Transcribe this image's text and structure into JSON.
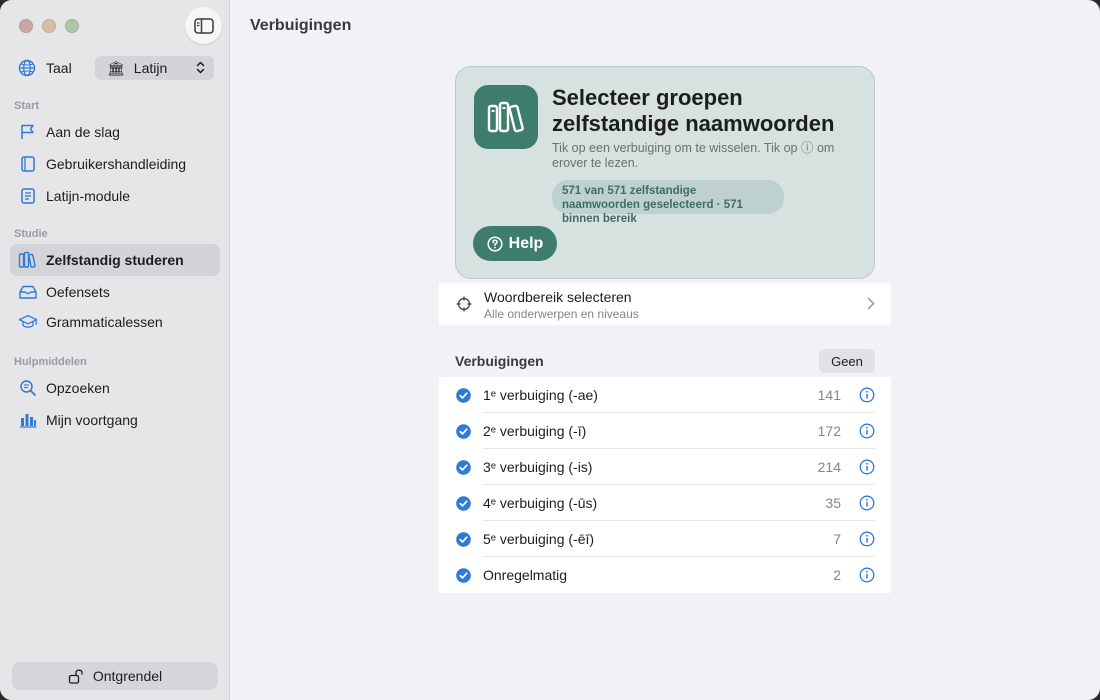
{
  "window": {
    "title": "Verbuigingen"
  },
  "sidebar": {
    "language_label": "Taal",
    "language_value": "Latijn",
    "sections": [
      {
        "header": "Start",
        "items": [
          {
            "label": "Aan de slag",
            "icon": "flag-icon"
          },
          {
            "label": "Gebruikershandleiding",
            "icon": "book-icon"
          },
          {
            "label": "Latijn-module",
            "icon": "module-book-icon"
          }
        ]
      },
      {
        "header": "Studie",
        "items": [
          {
            "label": "Zelfstandig studeren",
            "icon": "books-icon",
            "selected": true
          },
          {
            "label": "Oefensets",
            "icon": "tray-icon"
          },
          {
            "label": "Grammaticalessen",
            "icon": "graduation-cap-icon"
          }
        ]
      },
      {
        "header": "Hulpmiddelen",
        "items": [
          {
            "label": "Opzoeken",
            "icon": "magnifier-icon"
          },
          {
            "label": "Mijn voortgang",
            "icon": "chart-icon"
          }
        ]
      }
    ],
    "unlock_label": "Ontgrendel"
  },
  "hero": {
    "title": "Selecteer groepen zelfstandige naamwoorden",
    "subtitle": "Tik op een verbuiging om te wisselen. Tik op ⓘ om erover te lezen.",
    "pill": "571 van 571 zelfstandige naamwoorden geselecteerd · 571 binnen bereik",
    "help_label": "Help"
  },
  "range": {
    "title": "Woordbereik selecteren",
    "subtitle": "Alle onderwerpen en niveaus"
  },
  "declensions": {
    "header": "Verbuigingen",
    "none_label": "Geen",
    "rows": [
      {
        "label": "1ᵉ verbuiging (-ae)",
        "count": "141",
        "checked": true
      },
      {
        "label": "2ᵉ verbuiging (-ī)",
        "count": "172",
        "checked": true
      },
      {
        "label": "3ᵉ verbuiging (-is)",
        "count": "214",
        "checked": true
      },
      {
        "label": "4ᵉ verbuiging (-ūs)",
        "count": "35",
        "checked": true
      },
      {
        "label": "5ᵉ verbuiging (-ēī)",
        "count": "7",
        "checked": true
      },
      {
        "label": "Onregelmatig",
        "count": "2",
        "checked": true
      }
    ]
  },
  "colors": {
    "accent": "#2f7ad6",
    "brand_green": "#3e7d6c"
  }
}
